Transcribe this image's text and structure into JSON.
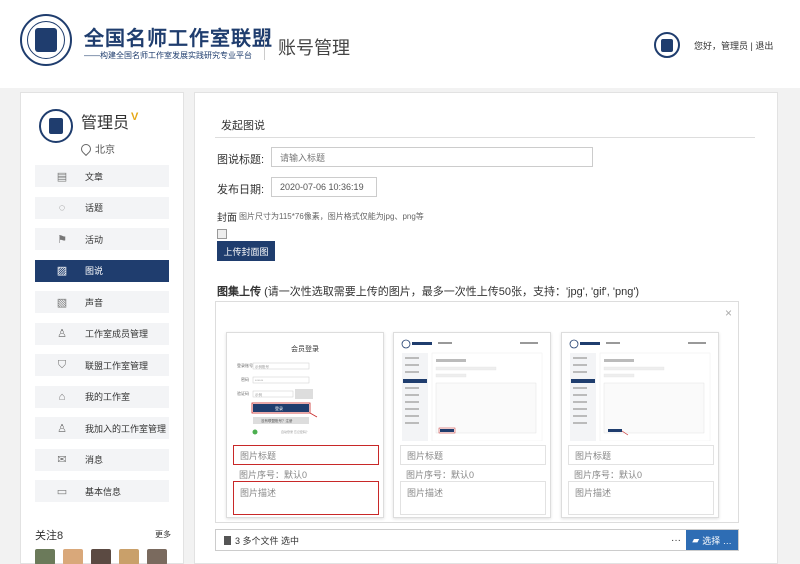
{
  "header": {
    "brand": "全国名师工作室联盟",
    "subtitle": "——构建全国名师工作室发展实践研究专业平台",
    "page_name": "账号管理",
    "greeting": "您好，管理员",
    "separator": "|",
    "logout": "退出"
  },
  "sidebar": {
    "name": "管理员",
    "vip": "V",
    "location": "北京",
    "items": [
      {
        "label": "文章",
        "icon": "document-icon",
        "glyph": "▤",
        "active": false
      },
      {
        "label": "话题",
        "icon": "chat-bubble-icon",
        "glyph": "◌",
        "active": false
      },
      {
        "label": "活动",
        "icon": "flag-icon",
        "glyph": "⚑",
        "active": false
      },
      {
        "label": "图说",
        "icon": "image-icon",
        "glyph": "▨",
        "active": true
      },
      {
        "label": "声音",
        "icon": "audio-file-icon",
        "glyph": "▧",
        "active": false
      },
      {
        "label": "工作室成员管理",
        "icon": "user-icon",
        "glyph": "♙",
        "active": false
      },
      {
        "label": "联盟工作室管理",
        "icon": "shield-icon",
        "glyph": "⛉",
        "active": false
      },
      {
        "label": "我的工作室",
        "icon": "home-icon",
        "glyph": "⌂",
        "active": false
      },
      {
        "label": "我加入的工作室管理",
        "icon": "user-join-icon",
        "glyph": "♙",
        "active": false
      },
      {
        "label": "消息",
        "icon": "mail-icon",
        "glyph": "✉",
        "active": false
      },
      {
        "label": "基本信息",
        "icon": "id-card-icon",
        "glyph": "▭",
        "active": false
      }
    ],
    "follow_label": "关注8",
    "more": "更多"
  },
  "form": {
    "section_title": "发起图说",
    "title_label": "图说标题:",
    "title_placeholder": "请输入标题",
    "date_label": "发布日期:",
    "date_value": "2020-07-06 10:36:19",
    "cover_label": "封面",
    "cover_hint": "图片尺寸为115*76像素，图片格式仅能为jpg、png等",
    "upload_cover_button": "上传封面图",
    "gallery_label": "图集上传",
    "gallery_hint": "(请一次性选取需要上传的图片，最多一次性上传50张，支持：'jpg', 'gif', 'png')"
  },
  "gallery": {
    "close": "×",
    "cards": [
      {
        "title_placeholder": "图片标题",
        "seq_label": "图片序号：默认0",
        "desc_placeholder": "图片描述"
      },
      {
        "title_placeholder": "图片标题",
        "seq_label": "图片序号：默认0",
        "desc_placeholder": "图片描述"
      },
      {
        "title_placeholder": "图片标题",
        "seq_label": "图片序号：默认0",
        "desc_placeholder": "图片描述"
      }
    ],
    "thumb1": {
      "heading": "会员登录",
      "account_label": "登录账号",
      "account_value": "示例账号",
      "password_label": "密码",
      "password_value": "******",
      "captcha_label": "验证码",
      "captcha_value": "示例",
      "login_button": "登录",
      "wechat_button": "没有联盟账号？注册",
      "footer": "自动登录  忘记密码？"
    },
    "file_status": "3 多个文件 选中",
    "dots": "···",
    "choose_button": "选择 …"
  },
  "colors": {
    "brand": "#1f3d6e",
    "accent": "#2e6db4",
    "highlight": "#c82828"
  }
}
